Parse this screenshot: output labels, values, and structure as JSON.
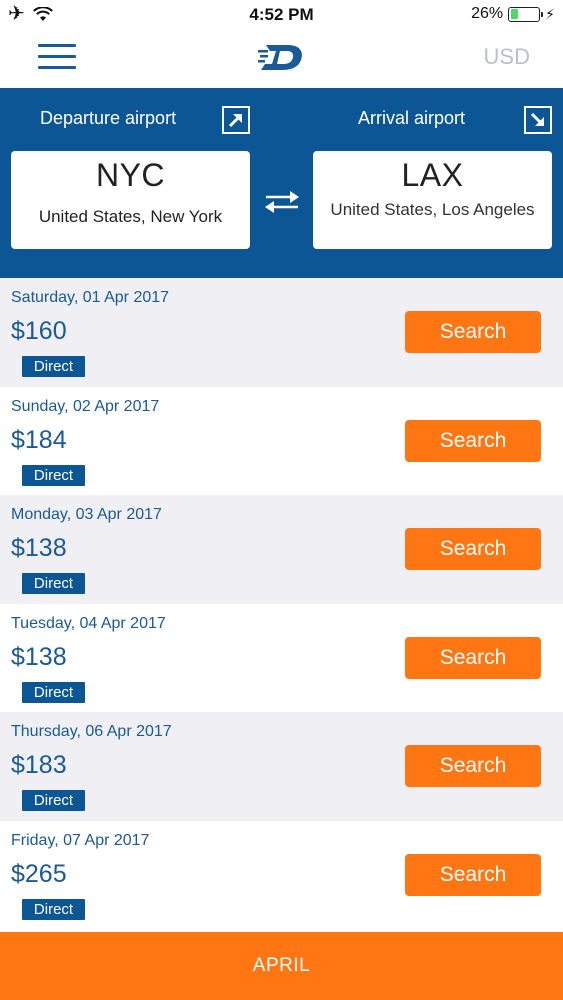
{
  "status_bar": {
    "time": "4:52 PM",
    "battery": "26%",
    "battery_level": 0.26,
    "icons": [
      "airplane-icon",
      "wifi-icon",
      "battery-icon",
      "charging-bolt-icon"
    ]
  },
  "navbar": {
    "currency": "USD",
    "icons": [
      "menu-icon",
      "logo-icon"
    ]
  },
  "airports": {
    "departure_label": "Departure airport",
    "arrival_label": "Arrival airport",
    "departure": {
      "code": "NYC",
      "place": "United States, New York"
    },
    "arrival": {
      "code": "LAX",
      "place": "United States, Los Angeles"
    },
    "icons": [
      "departure-arrow-icon",
      "arrival-arrow-icon",
      "swap-icon"
    ]
  },
  "results": [
    {
      "date": "Saturday, 01 Apr 2017",
      "price": "$160",
      "badge": "Direct",
      "button": "Search"
    },
    {
      "date": "Sunday, 02 Apr 2017",
      "price": "$184",
      "badge": "Direct",
      "button": "Search"
    },
    {
      "date": "Monday, 03 Apr 2017",
      "price": "$138",
      "badge": "Direct",
      "button": "Search"
    },
    {
      "date": "Tuesday, 04 Apr 2017",
      "price": "$138",
      "badge": "Direct",
      "button": "Search"
    },
    {
      "date": "Thursday, 06 Apr 2017",
      "price": "$183",
      "badge": "Direct",
      "button": "Search"
    },
    {
      "date": "Friday, 07 Apr 2017",
      "price": "$265",
      "badge": "Direct",
      "button": "Search"
    }
  ],
  "month_bar": {
    "label": "APRIL"
  },
  "colors": {
    "primary_blue": "#0d5696",
    "text_blue": "#1a5a96",
    "accent_orange": "#ff7613",
    "row_alt": "#efeff4",
    "battery_green": "#4cd964"
  }
}
